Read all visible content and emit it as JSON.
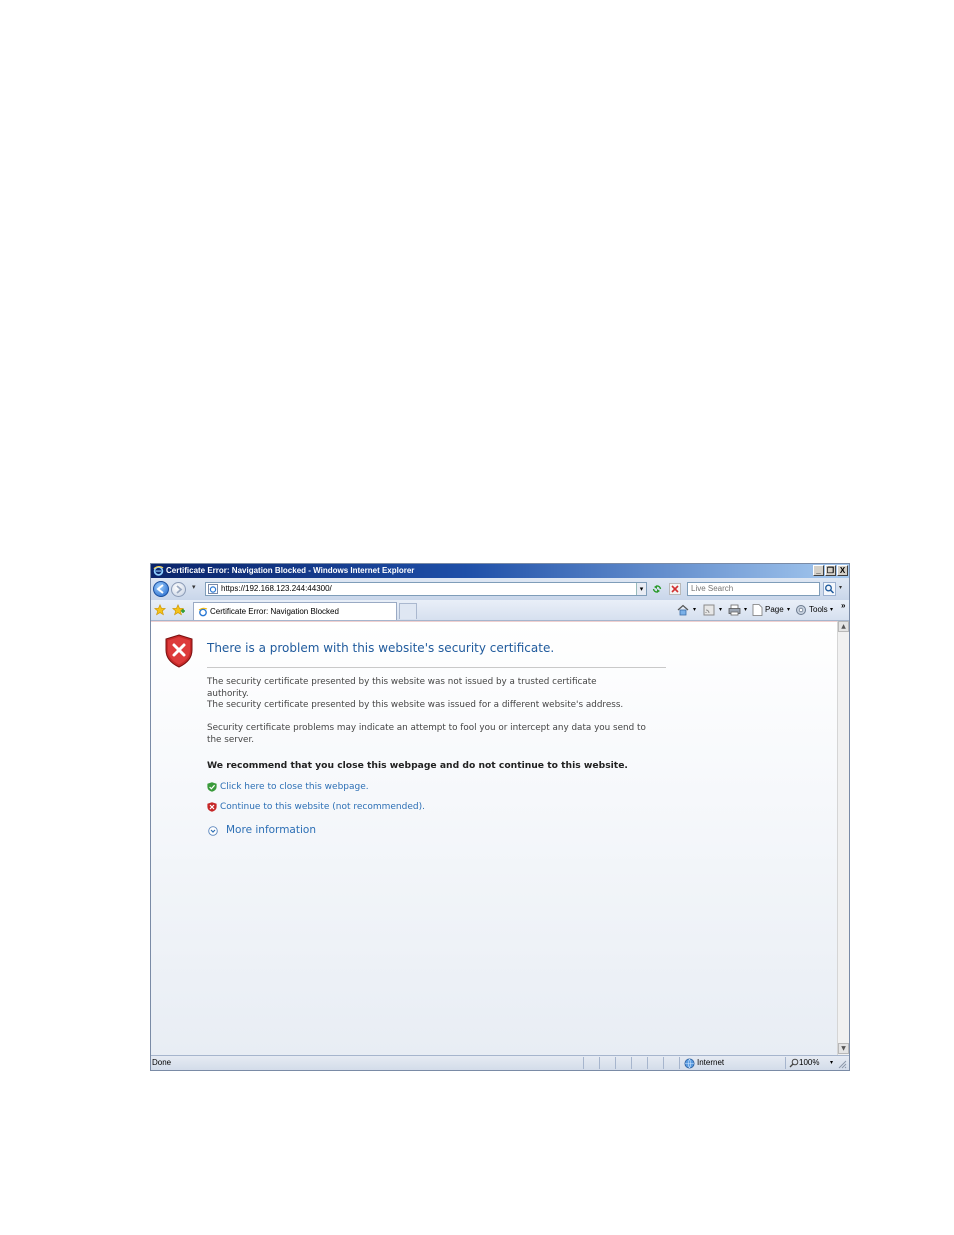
{
  "window": {
    "title": "Certificate Error: Navigation Blocked - Windows Internet Explorer",
    "minimize_glyph": "_",
    "restore_glyph": "❐",
    "close_glyph": "X"
  },
  "address_bar": {
    "url": "https://192.168.123.244:44300/",
    "dropdown_glyph": "▾",
    "search_placeholder": "Live Search"
  },
  "tabs": [
    {
      "label": "Certificate Error: Navigation Blocked",
      "active": true
    }
  ],
  "command_bar": {
    "page_label": "Page",
    "tools_label": "Tools",
    "chevron": "»"
  },
  "content": {
    "heading": "There is a problem with this website's security certificate.",
    "paragraph1_line1": "The security certificate presented by this website was not issued by a trusted certificate authority.",
    "paragraph1_line2": "The security certificate presented by this website was issued for a different website's address.",
    "paragraph2": "Security certificate problems may indicate an attempt to fool you or intercept any data you send to the server.",
    "recommendation": "We recommend that you close this webpage and do not continue to this website.",
    "close_link": "Click here to close this webpage.",
    "continue_link": "Continue to this website (not recommended).",
    "more_info": "More information"
  },
  "status_bar": {
    "status": "Done",
    "zone": "Internet",
    "zoom": "100%"
  },
  "colors": {
    "heading": "#1f5a9c",
    "link": "#2c6fb5",
    "shield_red": "#c62828",
    "shield_green": "#3a9a3a"
  }
}
